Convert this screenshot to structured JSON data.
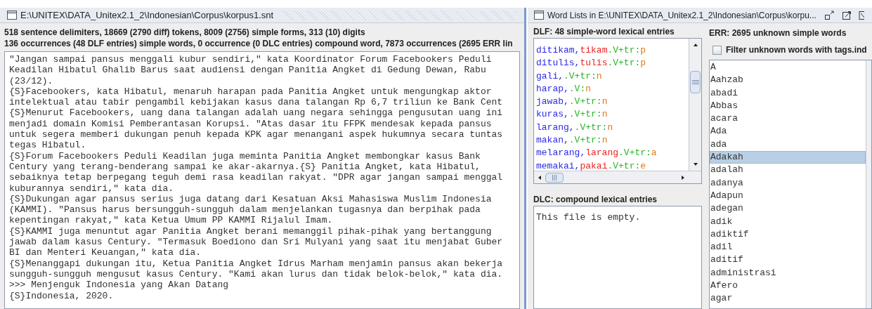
{
  "text_window": {
    "title": "E:\\UNITEX\\DATA_Unitex2.1_2\\Indonesian\\Corpus\\korpus1.snt",
    "stats": [
      "518 sentence delimiters, 18669 (2790 diff) tokens, 8009 (2756) simple forms, 313 (10) digits",
      "136 occurrences (48 DLF entries) simple words, 0 occurrence (0 DLC entries) compound word, 7873 occurrences (2695 ERR lin"
    ],
    "lines": [
      "\"Jangan sampai pansus menggali kubur sendiri,\" kata Koordinator Forum Facebookers Peduli",
      "Keadilan Hibatul Ghalib Barus saat audiensi dengan Panitia Angket di Gedung Dewan, Rabu",
      "(23/12).",
      "{S}Facebookers, kata Hibatul, menaruh harapan pada Panitia Angket untuk mengungkap aktor",
      "intelektual atau tabir pengambil kebijakan kasus dana talangan Rp 6,7 triliun ke Bank Cent",
      "{S}Menurut Facebookers, uang dana talangan adalah uang negara sehingga pengusutan uang ini",
      "menjadi domain Komisi Pemberantasan Korupsi. \"Atas dasar itu FFPK mendesak kepada pansus",
      "untuk segera memberi dukungan penuh kepada KPK agar menangani aspek hukumnya secara tuntas",
      "tegas Hibatul.",
      "{S}Forum Facebookers Peduli Keadilan juga meminta Panitia Angket membongkar kasus Bank",
      "Century yang terang-benderang sampai ke akar-akarnya.{S} Panitia Angket, kata Hibatul,",
      "sebaiknya tetap berpegang teguh demi rasa keadilan rakyat. \"DPR agar jangan sampai menggal",
      "kuburannya sendiri,\" kata dia.",
      "{S}Dukungan agar pansus serius juga datang dari Kesatuan Aksi Mahasiswa Muslim Indonesia",
      "(KAMMI). \"Pansus harus bersungguh-sungguh dalam menjelankan tugasnya dan berpihak pada",
      "kepentingan rakyat,\" kata Ketua Umum PP KAMMI Rijalul Imam.",
      "{S}KAMMI juga menuntut agar Panitia Angket berani memanggil pihak-pihak yang bertanggung",
      "jawab dalam kasus Century. \"Termasuk Boediono dan Sri Mulyani yang saat itu menjabat Guber",
      "BI dan Menteri Keuangan,\" kata dia.",
      "{S}Menanggapi dukungan itu, Ketua Panitia Angket Idrus Marham menjamin pansus akan bekerja",
      "sungguh-sungguh mengusut kasus Century. \"Kami akan lurus dan tidak belok-belok,\" kata dia.",
      ">>> Menjenguk Indonesia yang Akan Datang",
      "{S}Indonesia, 2020."
    ]
  },
  "word_lists_window": {
    "title": "Word Lists in E:\\UNITEX\\DATA_Unitex2.1_2\\Indonesian\\Corpus\\korpu...",
    "dlf": {
      "label": "DLF: 48 simple-word lexical entries",
      "entries": [
        {
          "form": "ditikam,",
          "lemma": "tikam",
          "code": ".V+tr:",
          "inflection": "p"
        },
        {
          "form": "ditulis,",
          "lemma": "tulis",
          "code": ".V+tr:",
          "inflection": "p"
        },
        {
          "form": "gali,",
          "code": ".V+tr:",
          "inflection": "n"
        },
        {
          "form": "harap,",
          "code": ".V:",
          "inflection": "n"
        },
        {
          "form": "jawab,",
          "code": ".V+tr:",
          "inflection": "n"
        },
        {
          "form": "kuras,",
          "code": ".V+tr:",
          "inflection": "n"
        },
        {
          "form": "larang,",
          "code": ".V+tr:",
          "inflection": "n"
        },
        {
          "form": "makan,",
          "code": ".V+tr:",
          "inflection": "n"
        },
        {
          "form": "melarang,",
          "lemma": "larang",
          "code": ".V+tr:",
          "inflection": "a"
        },
        {
          "form": "memakai,",
          "lemma": "pakai",
          "code": ".V+tr:",
          "inflection": "e"
        }
      ]
    },
    "dlc": {
      "label": "DLC: compound lexical entries",
      "content": "This file is empty."
    },
    "err": {
      "label": "ERR: 2695 unknown simple words",
      "filter": {
        "label": "Filter unknown words with tags.ind",
        "checked": false
      },
      "words": [
        {
          "text": "A",
          "selected": false
        },
        {
          "text": "Aahzab",
          "selected": false
        },
        {
          "text": "abadi",
          "selected": false
        },
        {
          "text": "Abbas",
          "selected": false
        },
        {
          "text": "acara",
          "selected": false
        },
        {
          "text": "Ada",
          "selected": false
        },
        {
          "text": "ada",
          "selected": false
        },
        {
          "text": "Adakah",
          "selected": true
        },
        {
          "text": "adalah",
          "selected": false
        },
        {
          "text": "adanya",
          "selected": false
        },
        {
          "text": "Adapun",
          "selected": false
        },
        {
          "text": "adegan",
          "selected": false
        },
        {
          "text": "adik",
          "selected": false
        },
        {
          "text": "adiktif",
          "selected": false
        },
        {
          "text": "adil",
          "selected": false
        },
        {
          "text": "aditif",
          "selected": false
        },
        {
          "text": "administrasi",
          "selected": false
        },
        {
          "text": "Afero",
          "selected": false
        },
        {
          "text": "agar",
          "selected": false
        }
      ]
    }
  }
}
